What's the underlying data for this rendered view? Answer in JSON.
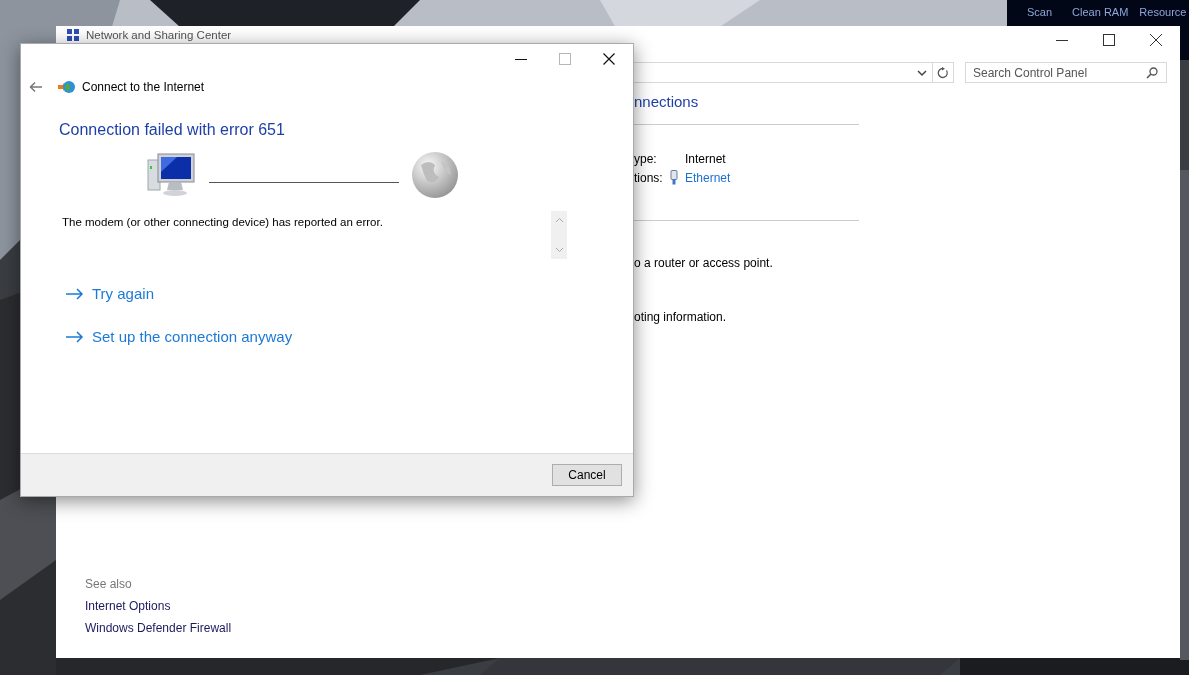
{
  "desktop_toolbar": {
    "items": [
      "Scan",
      "Clean RAM",
      "Resource"
    ]
  },
  "background_window": {
    "title": "Network and Sharing Center",
    "search": {
      "placeholder": "Search Control Panel"
    },
    "heading": "nnections",
    "details": [
      {
        "label": "ype:",
        "value": "Internet",
        "kind": "text"
      },
      {
        "label": "tions:",
        "value": "Ethernet",
        "kind": "link"
      }
    ],
    "notes": [
      "o a router or access point.",
      "oting information."
    ],
    "see_also": {
      "title": "See also",
      "links": [
        "Internet Options",
        "Windows Defender Firewall"
      ]
    }
  },
  "dialog": {
    "title": "Connect to the Internet",
    "heading": "Connection failed with error 651",
    "message": "The modem (or other connecting device) has reported an error.",
    "controls": [
      {
        "kind": "minimize",
        "disabled": false
      },
      {
        "kind": "maximize",
        "disabled": true
      },
      {
        "kind": "close",
        "disabled": false
      }
    ],
    "links": [
      "Try again",
      "Set up the connection anyway"
    ],
    "buttons": [
      "Cancel"
    ]
  }
}
